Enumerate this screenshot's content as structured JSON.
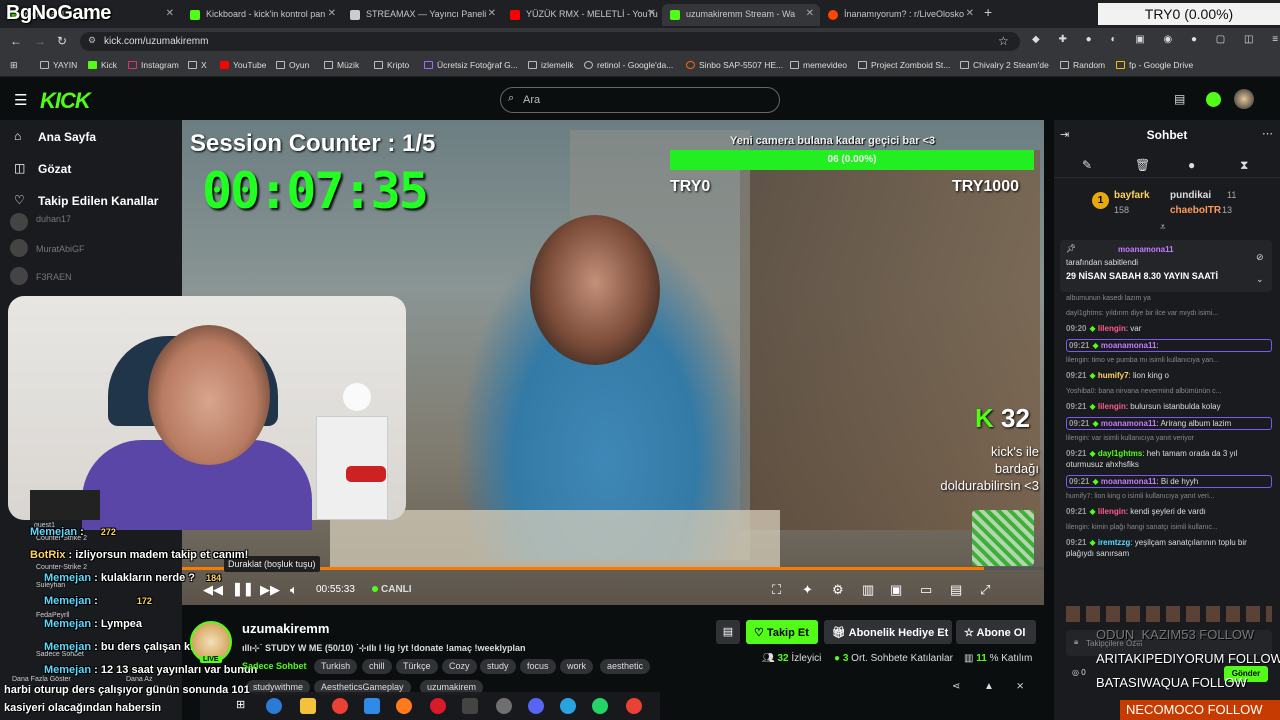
{
  "overlay": {
    "brand": "BgNoGame",
    "goal_top_right": "TRY0 (0.00%)"
  },
  "browser": {
    "tabs": [
      {
        "title": "Kickboard",
        "color": "#53fc18"
      },
      {
        "title": "Kickboard - kick'in kontrol pan",
        "color": "#53fc18"
      },
      {
        "title": "STREAMAX — Yayıncı Paneli",
        "color": "#cccccc"
      },
      {
        "title": "YÜZÜK RMX - MELETLİ - YouTu",
        "color": "#ff0000"
      },
      {
        "title": "uzumakiremm Stream - Wa",
        "color": "#53fc18"
      },
      {
        "title": "İnanamıyorum? : r/LiveOlosko",
        "color": "#ff4500"
      }
    ],
    "url": "kick.com/uzumakiremm",
    "bookmarks": [
      "YAYIN",
      "Kick",
      "Instagram",
      "X",
      "YouTube",
      "Oyun",
      "Müzik",
      "Kripto",
      "Ücretsiz Fotoğraf G...",
      "izlemelik",
      "retinol - Google'da...",
      "Sinbo SAP-5507 HE...",
      "memevideo",
      "Project Zomboid St...",
      "Chivalry 2 Steam'de",
      "Random",
      "fp - Google Drive"
    ]
  },
  "kick": {
    "logo": "KICK",
    "search_placeholder": "Ara",
    "nav": {
      "home": "Ana Sayfa",
      "browse": "Gözat",
      "following": "Takip Edilen Kanallar"
    },
    "channels": [
      "duhan17",
      "MuratAbiGF",
      "F3RAEN"
    ]
  },
  "video": {
    "session": "Session Counter : 1/5",
    "timer": "00:07:35",
    "goal_label": "Yeni camera bulana kadar geçici bar <3",
    "goal_text": "06 (0.00%)",
    "goal_fraction": 0.0,
    "goal_left": "TRY0",
    "goal_right": "TRY1000",
    "kick_count": "32",
    "kick_text": [
      "kick's ile",
      "bardağı",
      "doldurabilirsin <3"
    ],
    "current_time": "00:55:33",
    "live": "CANLI",
    "pause_tooltip": "Duraklat (boşluk tuşu)",
    "progress": 0.93
  },
  "overlay_chat": [
    {
      "name": "Memejan",
      "sep": ":",
      "text": "",
      "badge": "272"
    },
    {
      "name": "BotRix",
      "sep": ":",
      "text": "izliyorsun madem takip et canım!",
      "badge": ""
    },
    {
      "name": "Memejan",
      "sep": ":",
      "text": "kulakların nerde ?",
      "badge": "184"
    },
    {
      "name": "Memejan",
      "sep": ":",
      "text": "",
      "badge": "172"
    },
    {
      "name": "Memejan",
      "sep": ":",
      "text": "Lympea",
      "badge": ""
    },
    {
      "name": "Memejan",
      "sep": ":",
      "text": "bu ders çalışan kız dimi",
      "badge": ""
    },
    {
      "name": "Memejan",
      "sep": ":",
      "text": "12 13 saat yayınları var bunun",
      "badge": ""
    }
  ],
  "overlay_small": [
    "guest1",
    "Counter-Strike 2",
    "Counter-Strike 2",
    "Suleyhan",
    "FedaPeyrll",
    "Sadece Sohbet",
    "Dana Fazla Göster",
    "Dana Az"
  ],
  "bottom_caption": [
    "harbi oturup ders çalışıyor günün sonunda 101",
    "kasiyeri olacağından habersin"
  ],
  "stream": {
    "name": "uzumakiremm",
    "live": "LIVE",
    "title": "ıllı⊹˙ STUDY W ME (50/10) ˙⊹ıllı l !ig !yt !donate !amaç !weeklyplan",
    "category": "Sadece Sohbet",
    "tags": [
      "Turkish",
      "chill",
      "Türkçe",
      "Cozy",
      "study",
      "focus",
      "work",
      "aesthetic"
    ],
    "tags2": [
      "studywithme",
      "AestheticsGameplay",
      "uzumakirem"
    ],
    "follow": "Takip Et",
    "gift": "Abonelik Hediye Et",
    "subscribe": "Abone Ol",
    "viewers": "32",
    "viewers_label": "İzleyici",
    "chatters": "3",
    "chatters_label": "Ort. Sohbete Katılanlar",
    "participation": "11",
    "participation_label": "% Katılım"
  },
  "chat": {
    "title": "Sohbet",
    "gifter_rank": "1",
    "gifters": [
      {
        "name": "bayfark",
        "value": "158"
      },
      {
        "name": "pundikai",
        "value": "11"
      },
      {
        "name": "chaeboITR",
        "value": "13"
      }
    ],
    "pinned_by": "moanamona11",
    "pinned_label": "tarafından sabitlendi",
    "pinned_text": "29 NİSAN SABAH 8.30 YAYIN SAATİ",
    "messages": [
      {
        "kind": "reply",
        "text": "albumunun kasedi lazım ya"
      },
      {
        "kind": "reply",
        "text": "dayl1ghtms: yıldırım diye bir ilce var mıydı isimi..."
      },
      {
        "time": "09:20",
        "user": "lilengin",
        "color": "#ff5a8a",
        "text": "var"
      },
      {
        "time": "09:21",
        "user": "moanamona11",
        "color": "#c57bff",
        "text": "",
        "hl": true
      },
      {
        "kind": "reply",
        "text": "lilengin: timo ve pumba mı isimli kullanıcıya yan..."
      },
      {
        "time": "09:21",
        "user": "humify7",
        "color": "#ffd35b",
        "text": "lion king o"
      },
      {
        "kind": "reply",
        "text": "Yoshiba0: bana nirvana nevermind albümünün c..."
      },
      {
        "time": "09:21",
        "user": "lilengin",
        "color": "#ff5a8a",
        "text": "bulursun istanbulda kolay"
      },
      {
        "time": "09:21",
        "user": "moanamona11",
        "color": "#c57bff",
        "text": "Arirang album lazim",
        "hl": true
      },
      {
        "kind": "reply",
        "text": "lilengin: var isimli kullanıcıya yanıt veriyor"
      },
      {
        "time": "09:21",
        "user": "dayl1ghtms",
        "color": "#53fc18",
        "text": "heh tamam orada da 3 yıl oturmusuz ahxhsfiks"
      },
      {
        "time": "09:21",
        "user": "moanamona11",
        "color": "#c57bff",
        "text": "Bi de hyyh",
        "hl": true
      },
      {
        "kind": "reply",
        "text": "humify7: lion king o isimli kullanıcıya yanıt veri..."
      },
      {
        "time": "09:21",
        "user": "lilengin",
        "color": "#ff5a8a",
        "text": "kendi şeyleri de vardı"
      },
      {
        "kind": "reply",
        "text": "lilengin: kimin plağı hangi sanatçı isimli kullanıc..."
      },
      {
        "time": "09:21",
        "user": "iremtzzg",
        "color": "#5bd9ff",
        "text": "yeşilçam sanatçılarının toplu bir plağıydı sanırsam"
      }
    ],
    "input_placeholder": "Takipçilere Özel",
    "input_count": "0",
    "send": "Gönder"
  },
  "follow_overlay": [
    "ODUN_KAZIM53 FOLLOW",
    "ARITAKIPEDIYORUM FOLLOW",
    "BATASIWAQUA FOLLOW",
    "NECOMOCO FOLLOW"
  ],
  "colors": {
    "kick_green": "#53fc18",
    "bg": "#0b0e0f",
    "panel": "#191b1f",
    "progress": "#f57c00"
  }
}
